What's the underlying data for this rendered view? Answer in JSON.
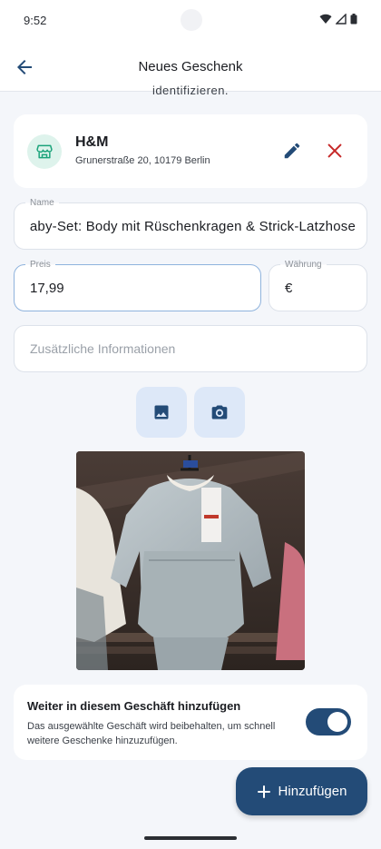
{
  "status_bar": {
    "time": "9:52"
  },
  "app_bar": {
    "title": "Neues Geschenk",
    "back_icon": "arrow-back-icon"
  },
  "hint_text": "identifizieren.",
  "store": {
    "name": "H&M",
    "address": "Grunerstraße 20, 10179 Berlin",
    "icon": "store-icon",
    "icon_color": "#1aa37a"
  },
  "form": {
    "name_label": "Name",
    "name_value": "Baby-Set: Body mit Rüschenkragen & Strick-Latzhose",
    "price_label": "Preis",
    "price_value": "17,99",
    "currency_label": "Währung",
    "currency_value": "€",
    "info_placeholder": "Zusätzliche Informationen"
  },
  "photo_buttons": [
    "image-icon",
    "camera-icon"
  ],
  "keep_store": {
    "title": "Weiter in diesem Geschäft hinzufügen",
    "description": "Das ausgewählte Geschäft wird beibehalten, um schnell weitere Geschenke hinzuzufügen.",
    "enabled": true
  },
  "fab": {
    "label": "Hinzufügen"
  },
  "colors": {
    "primary": "#234b77",
    "danger": "#c62828",
    "accent_green": "#1aa37a"
  }
}
